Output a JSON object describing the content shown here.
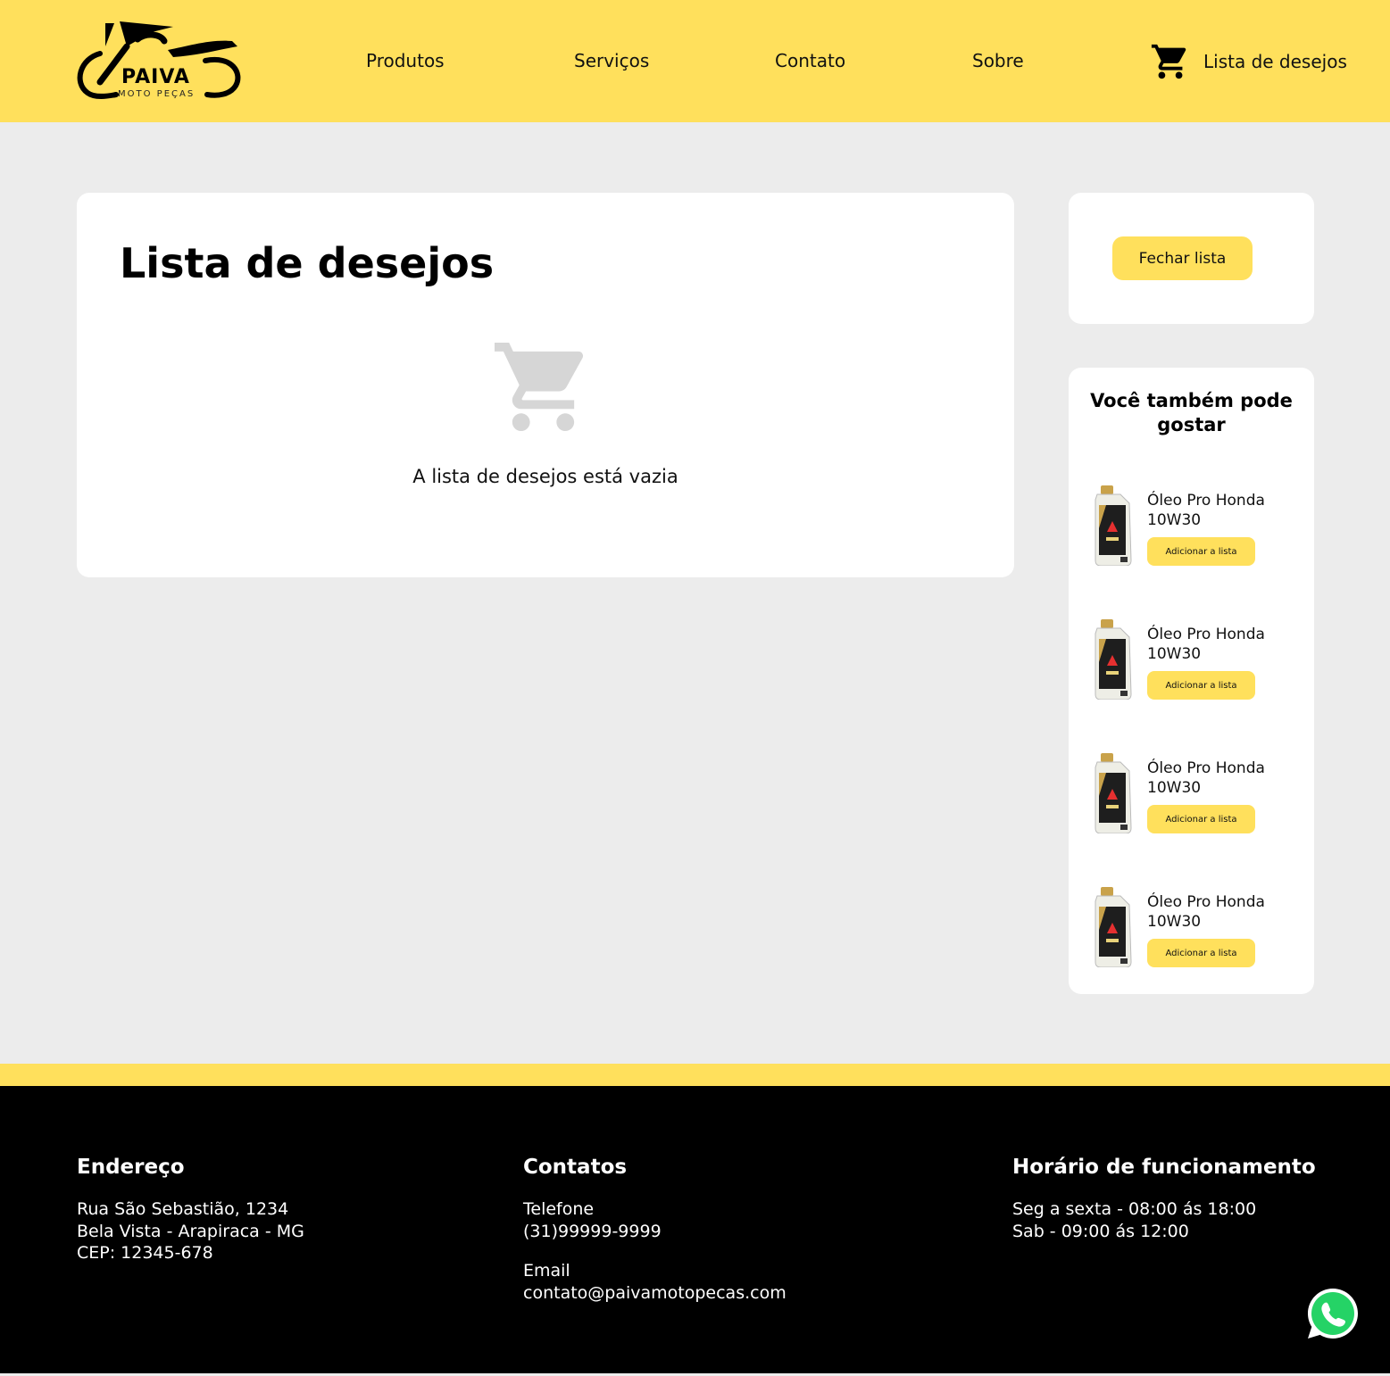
{
  "header": {
    "logo_name": "PAIVA",
    "logo_sub": "MOTO PEÇAS",
    "nav": [
      "Produtos",
      "Serviços",
      "Contato",
      "Sobre"
    ],
    "wishlist_label": "Lista de desejos"
  },
  "main": {
    "title": "Lista de desejos",
    "empty_message": "A lista de desejos está vazia"
  },
  "sidebar": {
    "close_button": "Fechar lista",
    "recommend_title_line1": "Você também pode",
    "recommend_title_line2": "gostar",
    "items": [
      {
        "name_line1": "Óleo Pro Honda",
        "name_line2": "10W30",
        "button": "Adicionar a lista"
      },
      {
        "name_line1": "Óleo Pro Honda",
        "name_line2": "10W30",
        "button": "Adicionar a lista"
      },
      {
        "name_line1": "Óleo Pro Honda",
        "name_line2": "10W30",
        "button": "Adicionar a lista"
      },
      {
        "name_line1": "Óleo Pro Honda",
        "name_line2": "10W30",
        "button": "Adicionar a lista"
      }
    ]
  },
  "footer": {
    "address": {
      "title": "Endereço",
      "line1": "Rua São Sebastião, 1234",
      "line2": "Bela Vista - Arapiraca - MG",
      "line3": "CEP: 12345-678"
    },
    "contacts": {
      "title": "Contatos",
      "phone_label": "Telefone",
      "phone": "(31)99999-9999",
      "email_label": "Email",
      "email": "contato@paivamotopecas.com"
    },
    "hours": {
      "title": "Horário de funcionamento",
      "line1": "Seg a sexta - 08:00 ás 18:00",
      "line2": "Sab - 09:00 ás 12:00"
    }
  },
  "colors": {
    "brand_yellow": "#ffe05c",
    "background": "#ececec",
    "footer_bg": "#000000",
    "whatsapp_green": "#25d366"
  },
  "icons": [
    "motorcycle-logo-icon",
    "cart-icon",
    "empty-cart-icon",
    "oil-bottle-icon",
    "whatsapp-icon"
  ]
}
